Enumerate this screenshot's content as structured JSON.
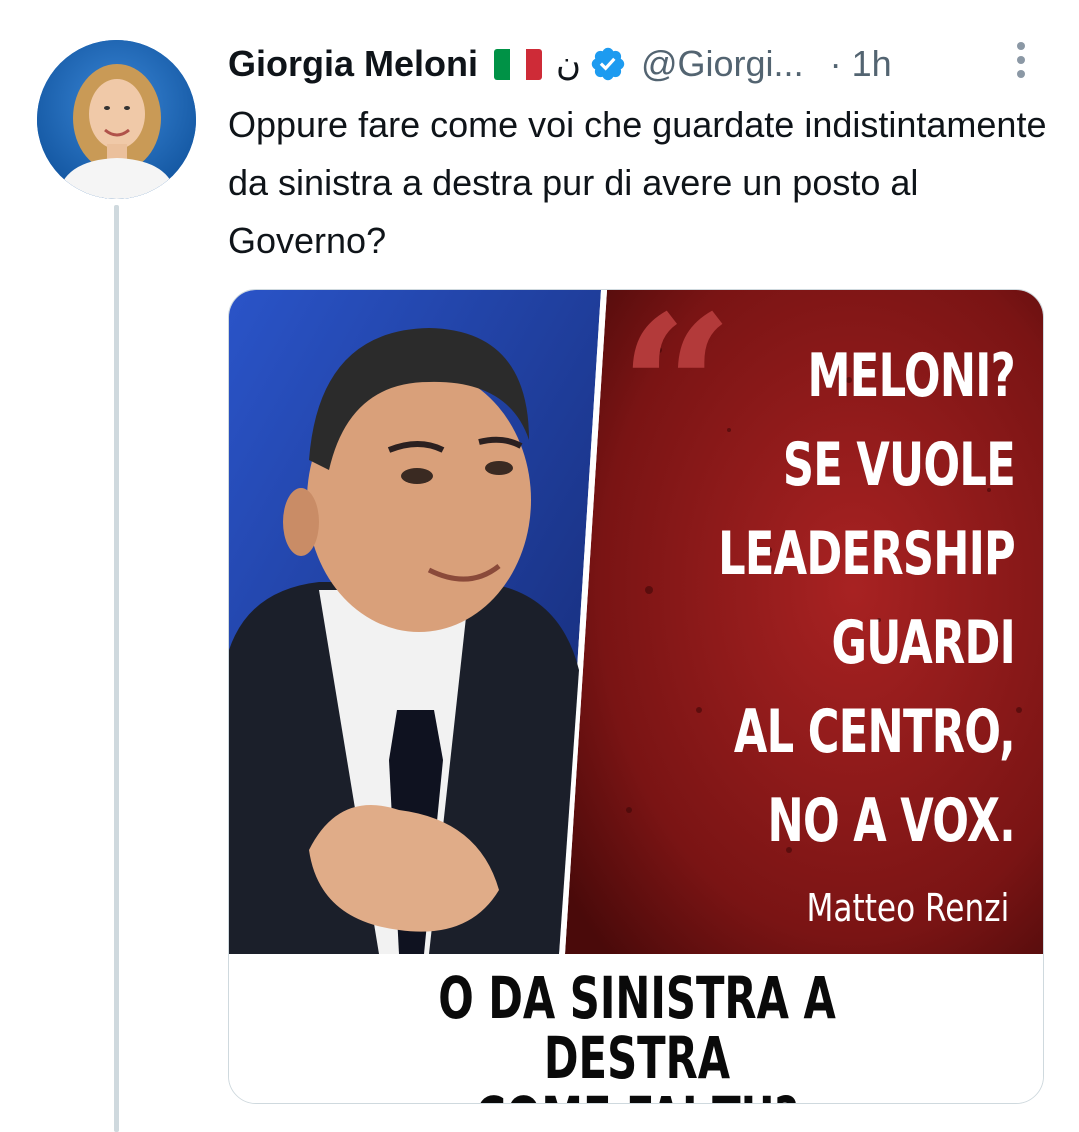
{
  "author": {
    "display_name": "Giorgia Meloni",
    "flag_icon": "italian-flag-icon",
    "extra_symbol": "ن",
    "verified_icon": "verified-badge-icon",
    "handle": "@Giorgi...",
    "separator": "·",
    "time": "1h"
  },
  "tweet": {
    "text": "Oppure fare come voi che guardate indistintamente da sinistra a destra pur di avere un posto al Governo?"
  },
  "media": {
    "quote_marks": "“",
    "quote": "MELONI?\nSE VUOLE\nLEADERSHIP\nGUARDI\nAL CENTRO,\nNO A VOX.",
    "attribution": "Matteo Renzi",
    "bottom_caption": "O DA SINISTRA A DESTRA\nCOME FAI TU?"
  },
  "colors": {
    "name": "#0f1419",
    "secondary": "#536471",
    "verified": "#1d9bf0",
    "thread_line": "#cfd9de",
    "poster_red": "#8e1c1c",
    "poster_blue": "#1f3f9e"
  }
}
